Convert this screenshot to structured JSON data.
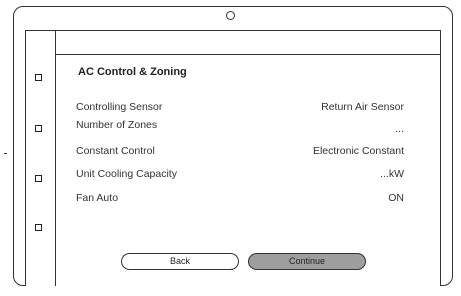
{
  "page": {
    "title": "AC Control & Zoning"
  },
  "settings": [
    {
      "label": "Controlling Sensor",
      "value": "Return Air Sensor"
    },
    {
      "label": "Number of Zones",
      "value": "..."
    },
    {
      "label": "Constant Control",
      "value": "Electronic Constant"
    },
    {
      "label": "Unit Cooling Capacity",
      "value": "...kW"
    },
    {
      "label": "Fan Auto",
      "value": "ON"
    }
  ],
  "buttons": {
    "back_label": "Back",
    "continue_label": "Continue"
  },
  "colors": {
    "continue_button_fill": "#9e9e9e",
    "outline": "#333333"
  }
}
